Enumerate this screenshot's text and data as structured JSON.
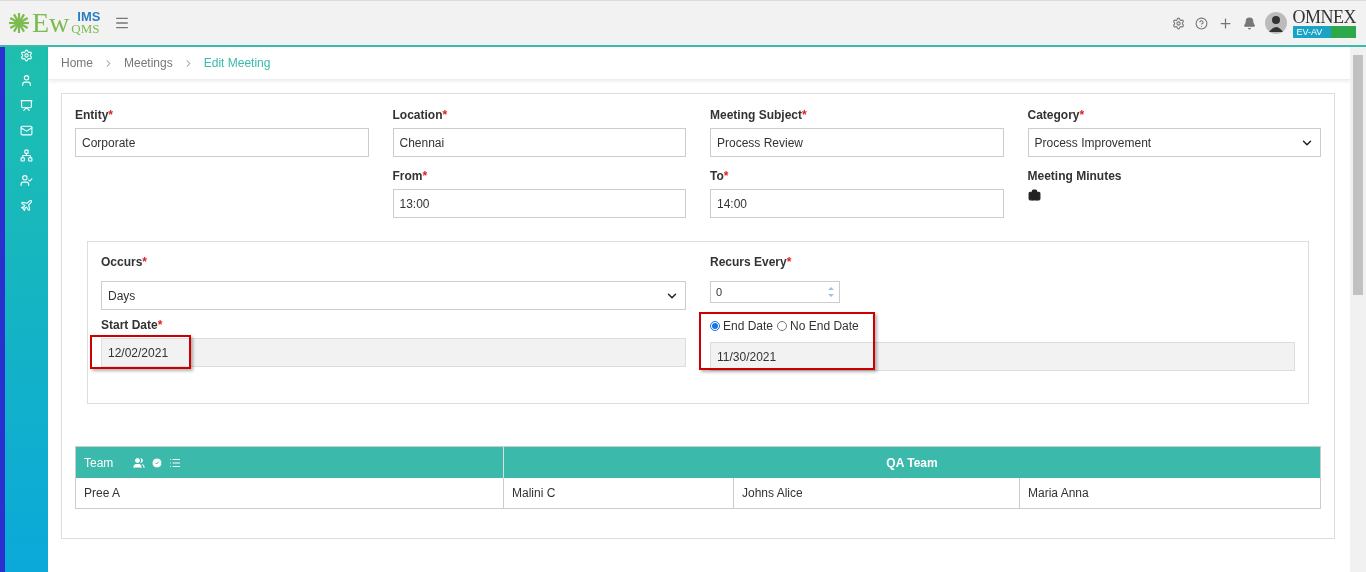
{
  "header": {
    "logo_main": "Ew",
    "logo_top": "IMS",
    "logo_bottom": "QMS",
    "brand": "OMNEX",
    "brand_tag": "EV-AV"
  },
  "breadcrumb": [
    {
      "label": "Home",
      "selected": false
    },
    {
      "label": "Meetings",
      "selected": false
    },
    {
      "label": "Edit Meeting",
      "selected": true
    }
  ],
  "form_rows": [
    [
      {
        "kind": "text",
        "label": "Entity",
        "required_mark": "*",
        "value": "Corporate"
      },
      {
        "kind": "text",
        "label": "Location",
        "required_mark": "*",
        "value": "Chennai"
      },
      {
        "kind": "text",
        "label": "Meeting Subject",
        "required_mark": "*",
        "value": "Process Review"
      },
      {
        "kind": "select",
        "label": "Category",
        "required_mark": "*",
        "value": "Process Improvement"
      }
    ],
    [
      {
        "kind": "blank"
      },
      {
        "kind": "text",
        "label": "From",
        "required_mark": "*",
        "value": "13:00"
      },
      {
        "kind": "text",
        "label": "To",
        "required_mark": "*",
        "value": "14:00"
      },
      {
        "kind": "attachment",
        "label": "Meeting Minutes"
      }
    ]
  ],
  "recurrence": {
    "occurs": {
      "label": "Occurs",
      "required_mark": "*",
      "value": "Days"
    },
    "recurs_every": {
      "label": "Recurs Every",
      "required_mark": "*",
      "value": "0"
    },
    "start_date": {
      "label": "Start Date",
      "required_mark": "*",
      "value": "12/02/2021",
      "highlighted": true
    },
    "end_options": [
      {
        "label": "End Date",
        "selected": true
      },
      {
        "label": "No End Date",
        "selected": false
      }
    ],
    "end_date": {
      "value": "11/30/2021",
      "highlighted": true
    }
  },
  "team": {
    "label": "Team",
    "group_label": "QA Team",
    "members": [
      "Pree A"
    ],
    "group_members": [
      "Malini C",
      "Johns Alice",
      "Maria Anna"
    ]
  }
}
